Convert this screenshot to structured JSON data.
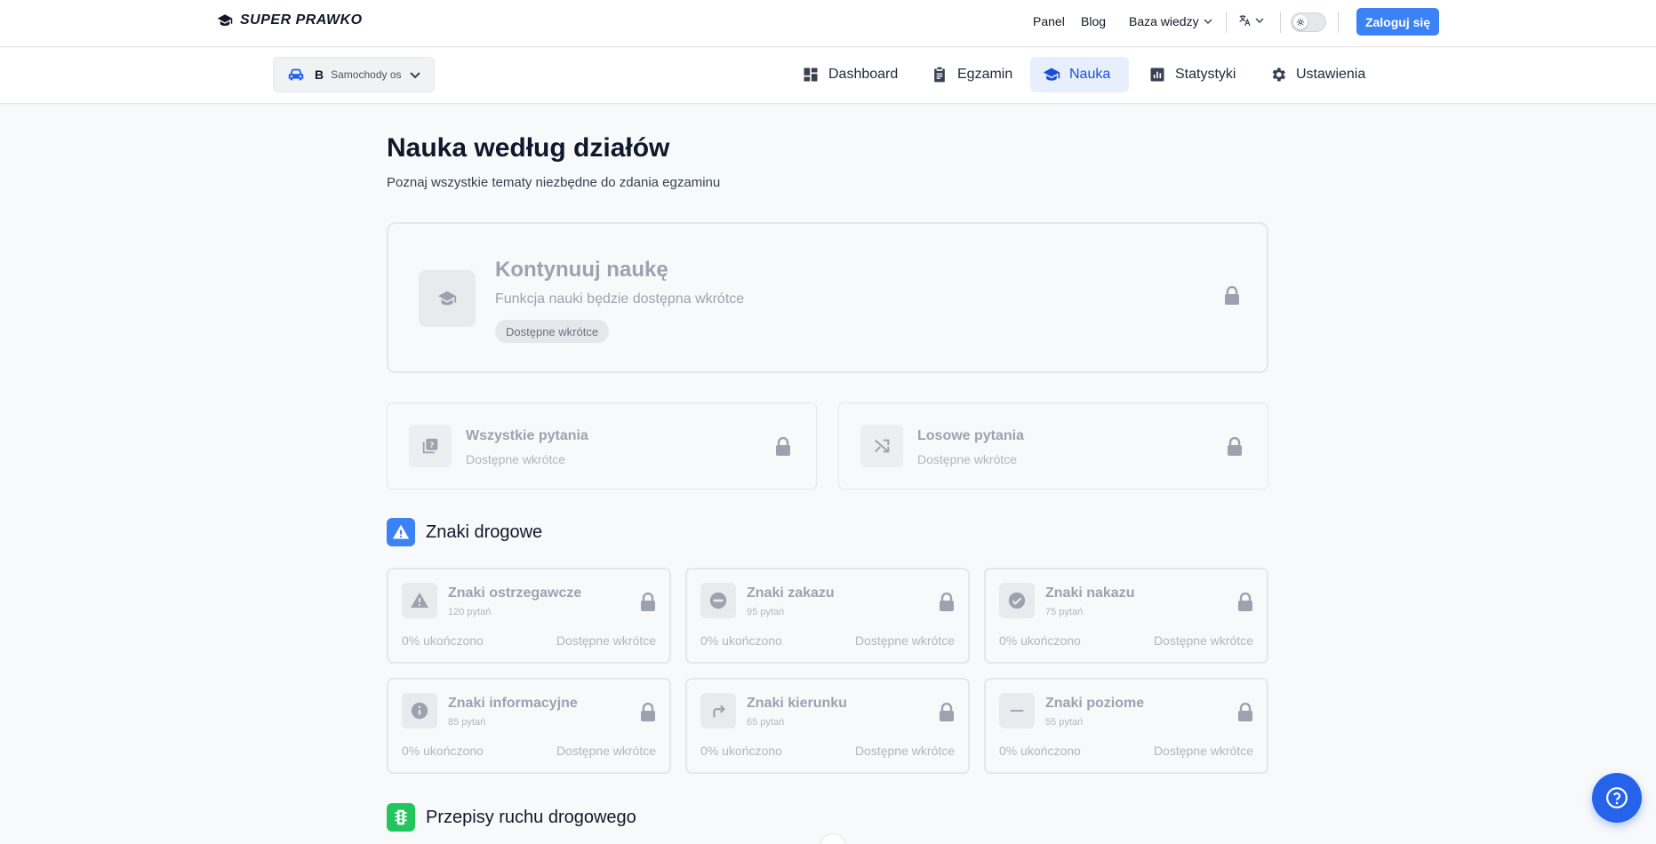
{
  "brand": {
    "name": "SUPER PRAWKO"
  },
  "topnav": {
    "panel": "Panel",
    "blog": "Blog",
    "knowledge": "Baza wiedzy",
    "login": "Zaloguj się"
  },
  "category": {
    "letter": "B",
    "name": "Samochody os"
  },
  "mainnav": [
    {
      "label": "Dashboard",
      "icon": "dashboard-icon"
    },
    {
      "label": "Egzamin",
      "icon": "clipboard-icon"
    },
    {
      "label": "Nauka",
      "icon": "graduation-cap-icon",
      "active": true
    },
    {
      "label": "Statystyki",
      "icon": "chart-icon"
    },
    {
      "label": "Ustawienia",
      "icon": "gear-icon"
    }
  ],
  "page": {
    "title": "Nauka według działów",
    "subtitle": "Poznaj wszystkie tematy niezbędne do zdania egzaminu"
  },
  "continue_card": {
    "title": "Kontynuuj naukę",
    "subtitle": "Funkcja nauki będzie dostępna wkrótce",
    "badge": "Dostępne wkrótce"
  },
  "mini_cards": [
    {
      "title": "Wszystkie pytania",
      "subtitle": "Dostępne wkrótce"
    },
    {
      "title": "Losowe pytania",
      "subtitle": "Dostępne wkrótce"
    }
  ],
  "sections": [
    {
      "title": "Znaki drogowe",
      "color": "#3b82f6",
      "topics": [
        {
          "title": "Znaki ostrzegawcze",
          "count": "120 pytań",
          "progress": "0% ukończono",
          "status": "Dostępne wkrótce",
          "icon": "warning-icon"
        },
        {
          "title": "Znaki zakazu",
          "count": "95 pytań",
          "progress": "0% ukończono",
          "status": "Dostępne wkrótce",
          "icon": "no-entry-icon"
        },
        {
          "title": "Znaki nakazu",
          "count": "75 pytań",
          "progress": "0% ukończono",
          "status": "Dostępne wkrótce",
          "icon": "check-circle-icon"
        },
        {
          "title": "Znaki informacyjne",
          "count": "85 pytań",
          "progress": "0% ukończono",
          "status": "Dostępne wkrótce",
          "icon": "info-icon"
        },
        {
          "title": "Znaki kierunku",
          "count": "65 pytań",
          "progress": "0% ukończono",
          "status": "Dostępne wkrótce",
          "icon": "turn-right-icon"
        },
        {
          "title": "Znaki poziome",
          "count": "55 pytań",
          "progress": "0% ukończono",
          "status": "Dostępne wkrótce",
          "icon": "horizontal-line-icon"
        }
      ]
    },
    {
      "title": "Przepisy ruchu drogowego",
      "color": "#22c55e"
    }
  ]
}
